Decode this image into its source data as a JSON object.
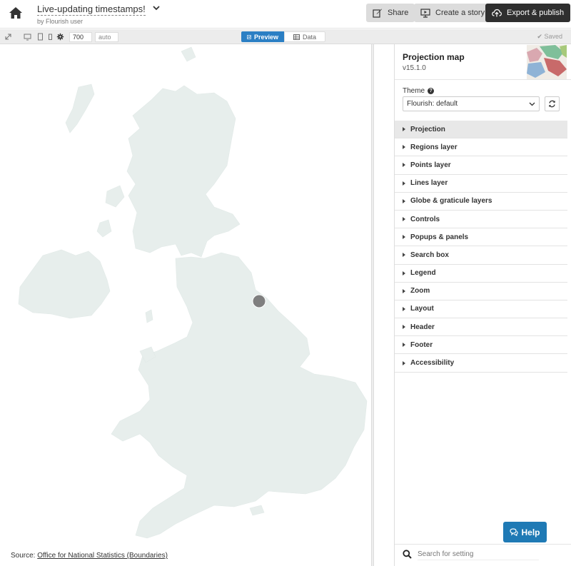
{
  "header": {
    "title": "Live-updating timestamps!",
    "byline": "by Flourish user",
    "share_label": "Share",
    "story_label": "Create a story",
    "export_label": "Export & publish"
  },
  "toolbar": {
    "width_value": "700",
    "height_value": "auto",
    "preview_label": "Preview",
    "data_label": "Data",
    "saved_label": "Saved"
  },
  "preview": {
    "source_prefix": "Source: ",
    "source_link": "Office for National Statistics (Boundaries)"
  },
  "panel": {
    "template_name": "Projection map",
    "template_version": "v15.1.0",
    "theme_label": "Theme",
    "theme_value": "Flourish: default",
    "sections": [
      "Projection",
      "Regions layer",
      "Points layer",
      "Lines layer",
      "Globe & graticule layers",
      "Controls",
      "Popups & panels",
      "Search box",
      "Legend",
      "Zoom",
      "Layout",
      "Header",
      "Footer",
      "Accessibility"
    ],
    "help_label": "Help",
    "search_placeholder": "Search for setting"
  },
  "colors": {
    "accent": "#2b7fc4",
    "help": "#1f7ab5",
    "export_button": "#2f2f2f",
    "map_land": "#e7eeec",
    "map_point": "#7f7f7f"
  }
}
